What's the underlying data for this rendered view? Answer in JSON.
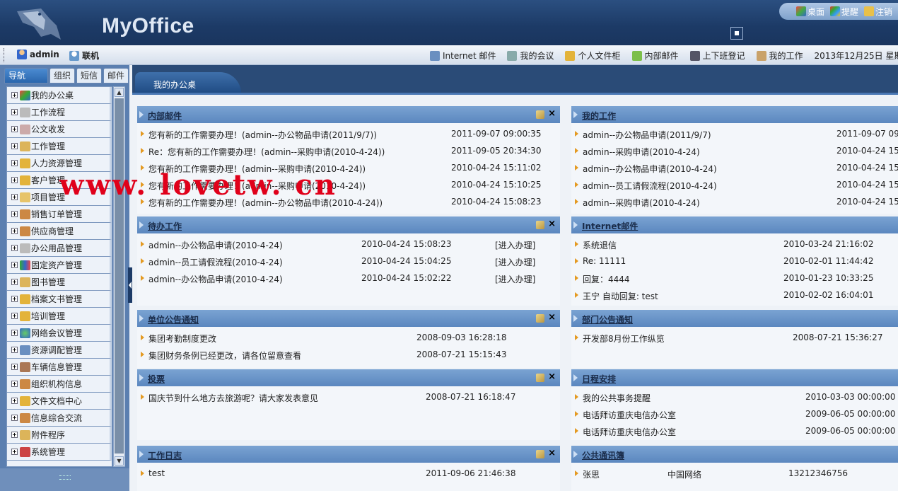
{
  "app": {
    "title": "MyOffice"
  },
  "topright": {
    "desktop": "桌面",
    "remind": "提醒",
    "logout": "注销"
  },
  "toolbar": {
    "user": "admin",
    "online": "联机",
    "links": [
      "Internet 邮件",
      "我的会议",
      "个人文件柜",
      "内部邮件",
      "上下班登记",
      "我的工作"
    ],
    "date": "2013年12月25日 星期"
  },
  "nav": {
    "tabs": [
      "导航",
      "组织",
      "短信",
      "邮件"
    ],
    "items": [
      "我的办公桌",
      "工作流程",
      "公文收发",
      "工作管理",
      "人力资源管理",
      "客户管理",
      "项目管理",
      "销售订单管理",
      "供应商管理",
      "办公用品管理",
      "固定资产管理",
      "图书管理",
      "档案文书管理",
      "培训管理",
      "网络会议管理",
      "资源调配管理",
      "车辆信息管理",
      "组织机构信息",
      "文件文档中心",
      "信息综合交流",
      "附件程序",
      "系统管理"
    ]
  },
  "main": {
    "tab": "我的办公桌"
  },
  "watermark": "www. lovetw. cn",
  "panels": {
    "internal_mail": {
      "title": "内部邮件",
      "rows": [
        [
          "您有新的工作需要办理！(admin--办公物品申请(2011/9/7))",
          "2011-09-07 09:00:35"
        ],
        [
          "Re：您有新的工作需要办理！(admin--采购申请(2010-4-24))",
          "2011-09-05 20:34:30"
        ],
        [
          "您有新的工作需要办理！(admin--采购申请(2010-4-24))",
          "2010-04-24 15:11:02"
        ],
        [
          "您有新的工作需要办理！(admin--采购申请(2010-4-24))",
          "2010-04-24 15:10:25"
        ],
        [
          "您有新的工作需要办理！(admin--办公物品申请(2010-4-24))",
          "2010-04-24 15:08:23"
        ]
      ]
    },
    "my_work": {
      "title": "我的工作",
      "rows": [
        [
          "admin--办公物品申请(2011/9/7)",
          "2011-09-07 09"
        ],
        [
          "admin--采购申请(2010-4-24)",
          "2010-04-24 15"
        ],
        [
          "admin--办公物品申请(2010-4-24)",
          "2010-04-24 15"
        ],
        [
          "admin--员工请假流程(2010-4-24)",
          "2010-04-24 15"
        ],
        [
          "admin--采购申请(2010-4-24)",
          "2010-04-24 15"
        ]
      ]
    },
    "todo": {
      "title": "待办工作",
      "rows": [
        [
          "admin--办公物品申请(2010-4-24)",
          "2010-04-24 15:08:23",
          "[进入办理]"
        ],
        [
          "admin--员工请假流程(2010-4-24)",
          "2010-04-24 15:04:25",
          "[进入办理]"
        ],
        [
          "admin--办公物品申请(2010-4-24)",
          "2010-04-24 15:02:22",
          "[进入办理]"
        ]
      ]
    },
    "internet_mail": {
      "title": "Internet邮件",
      "rows": [
        [
          "系统退信",
          "2010-03-24 21:16:02"
        ],
        [
          "Re: 11111",
          "2010-02-01 11:44:42"
        ],
        [
          "回复：4444",
          "2010-01-23 10:33:25"
        ],
        [
          "王宁 自动回复: test",
          "2010-02-02 16:04:01"
        ]
      ]
    },
    "unit_notice": {
      "title": "单位公告通知",
      "rows": [
        [
          "集团考勤制度更改",
          "2008-09-03 16:28:18"
        ],
        [
          "集团财务条例已经更改，请各位留意查看",
          "2008-07-21 15:15:43"
        ]
      ]
    },
    "dept_notice": {
      "title": "部门公告通知",
      "rows": [
        [
          "开发部8月份工作纵览",
          "2008-07-21 15:36:27"
        ]
      ]
    },
    "vote": {
      "title": "投票",
      "rows": [
        [
          "国庆节到什么地方去旅游呢？请大家发表意见",
          "2008-07-21 16:18:47"
        ]
      ]
    },
    "schedule": {
      "title": "日程安排",
      "rows": [
        [
          "我的公共事务提醒",
          "2010-03-03 00:00:00"
        ],
        [
          "电话拜访重庆电信办公室",
          "2009-06-05 00:00:00"
        ],
        [
          "电话拜访重庆电信办公室",
          "2009-06-05 00:00:00"
        ]
      ]
    },
    "worklog": {
      "title": "工作日志",
      "rows": [
        [
          "test",
          "2011-09-06 21:46:38"
        ]
      ]
    },
    "contacts": {
      "title": "公共通讯簿",
      "rows": [
        [
          "张思",
          "中国网络",
          "13212346756"
        ]
      ]
    }
  },
  "colors": {
    "header": "#1c3a66",
    "panel_head": "#6a96cb",
    "bullet": "#e49a22",
    "watermark": "#e0001a"
  }
}
